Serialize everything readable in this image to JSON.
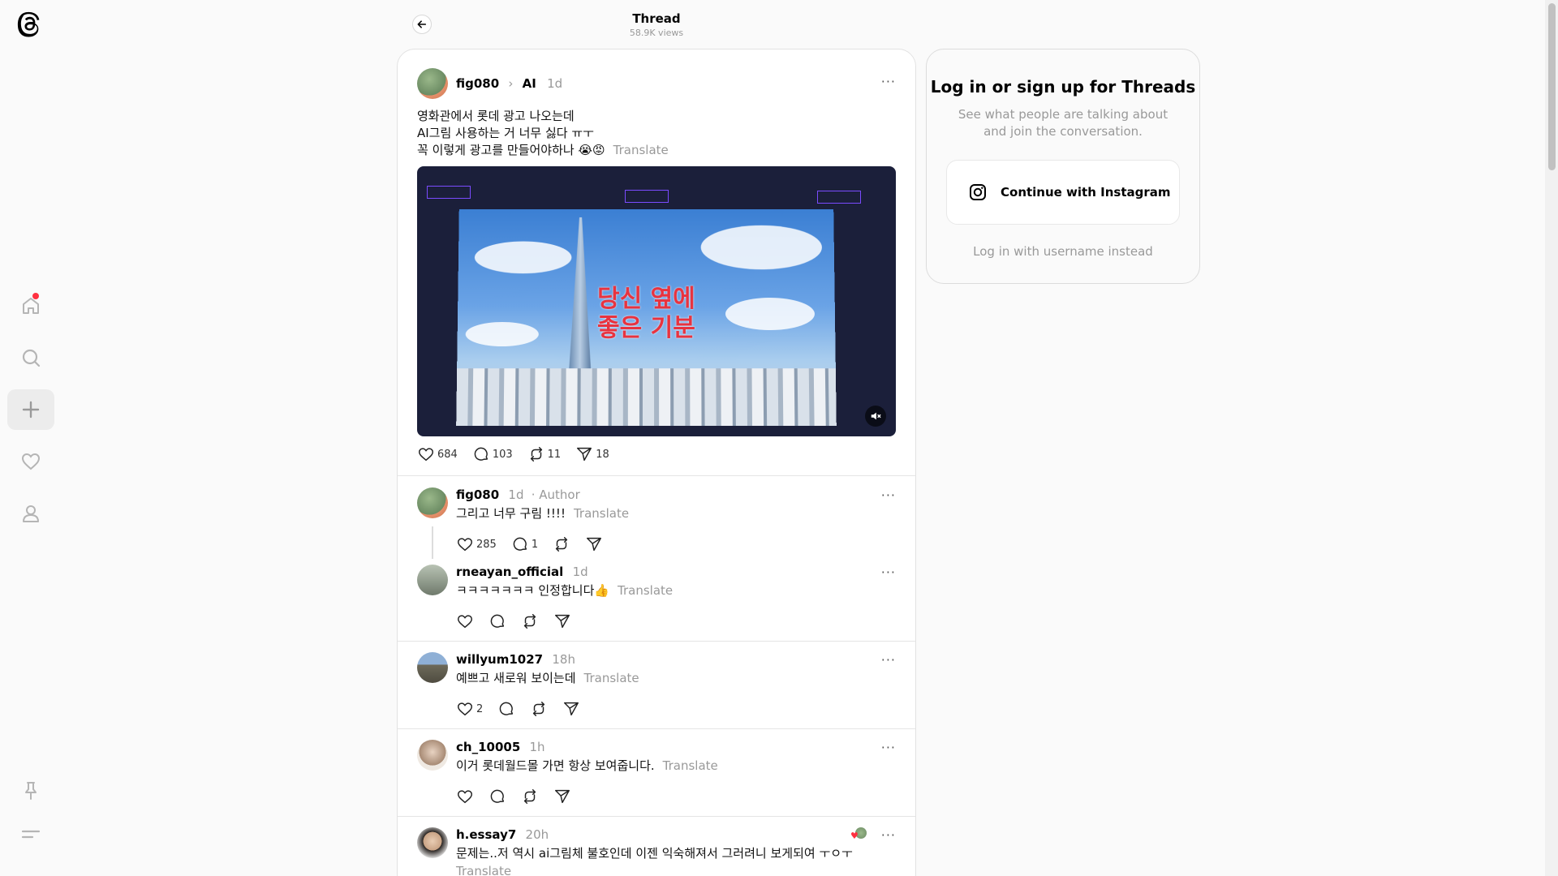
{
  "header": {
    "title": "Thread",
    "views": "58.9K views"
  },
  "nav": {
    "items": [
      "home-icon",
      "search-icon",
      "create-icon",
      "activity-icon",
      "profile-icon"
    ],
    "bottom": [
      "pin-icon",
      "menu-icon"
    ],
    "notification_color": "#ff3040"
  },
  "main_post": {
    "username": "fig080",
    "tag": "AI",
    "time": "1d",
    "lines": [
      "영화관에서 롯데 광고 나오는데",
      "AI그림 사용하는 거 너무 싫다 ㅠㅜ",
      "꼭 이렇게 광고를 만들어야하나 😭😡"
    ],
    "translate": "Translate",
    "video_text": [
      "당신 옆에",
      "좋은 기분"
    ],
    "likes": "684",
    "comments": "103",
    "reposts": "11",
    "shares": "18"
  },
  "replies": [
    {
      "username": "fig080",
      "time": "1d",
      "author": "· Author",
      "text": "그리고 너무 구림 !!!!",
      "translate": "Translate",
      "likes": "285",
      "comments": "1"
    },
    {
      "username": "rneayan_official",
      "time": "1d",
      "text": "ㅋㅋㅋㅋㅋㅋㅋ 인정합니다👍",
      "translate": "Translate"
    },
    {
      "username": "willyum1027",
      "time": "18h",
      "text": "예쁘고 새로워 보이는데",
      "translate": "Translate",
      "likes": "2"
    },
    {
      "username": "ch_10005",
      "time": "1h",
      "text": "이거 롯데월드몰 가면 항상 보여줍니다.",
      "translate": "Translate"
    },
    {
      "username": "h.essay7",
      "time": "20h",
      "text": "문제는..저 역시 ai그림체 불호인데 이젠 익숙해져서 그러려니 보게되여 ㅜㅇㅜ",
      "translate": "Translate"
    }
  ],
  "login": {
    "title": "Log in or sign up for Threads",
    "subtitle": "See what people are talking about and join the conversation.",
    "instagram_button": "Continue with Instagram",
    "alt_login": "Log in with username instead"
  }
}
